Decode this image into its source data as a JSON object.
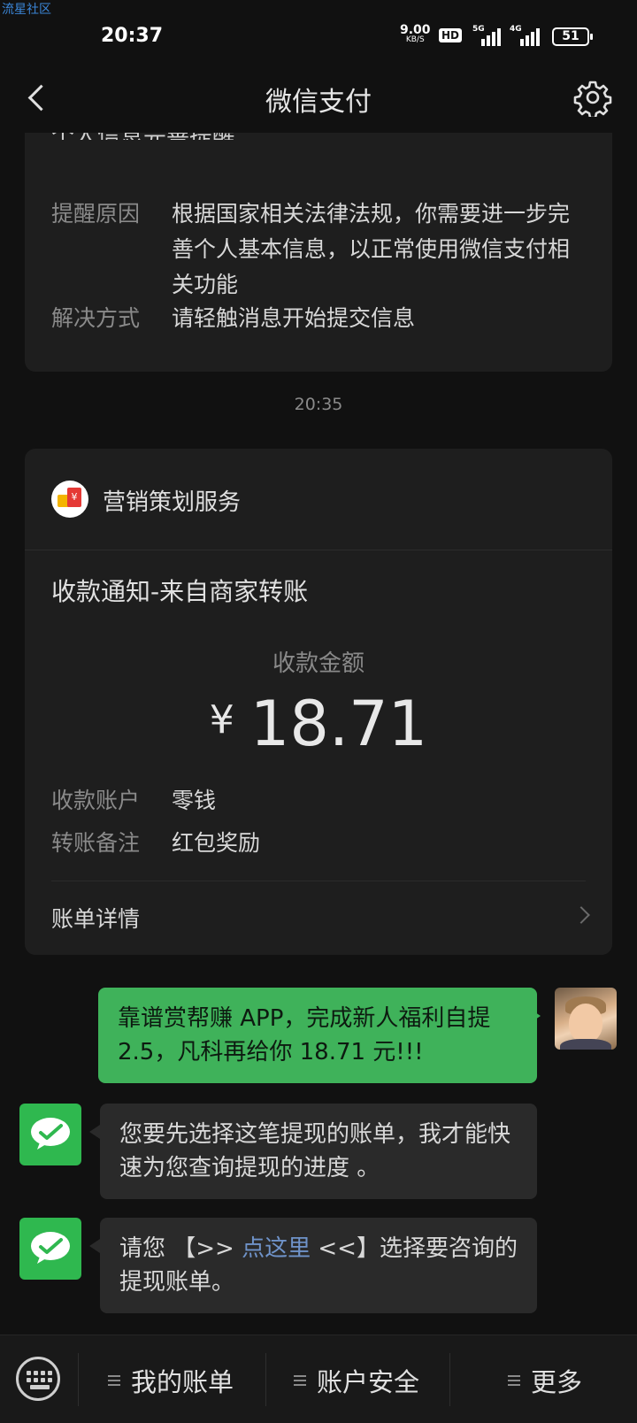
{
  "watermark": "流星社区",
  "status_bar": {
    "time": "20:37",
    "net_rate": "9.00",
    "net_unit": "KB/S",
    "hd": "HD",
    "signal1": "5G",
    "signal2": "4G",
    "battery": "51"
  },
  "nav": {
    "title": "微信支付",
    "back_icon": "back-arrow-icon",
    "settings_icon": "gear-icon"
  },
  "reminder_card": {
    "clipped_title": "个人信息完善提醒",
    "reason_label": "提醒原因",
    "reason_value": "根据国家相关法律法规，你需要进一步完善个人基本信息，以正常使用微信支付相关功能",
    "method_label": "解决方式",
    "method_value": "请轻触消息开始提交信息"
  },
  "timestamp": "20:35",
  "payment_card": {
    "service_name": "营销策划服务",
    "title": "收款通知-来自商家转账",
    "amount_label": "收款金额",
    "currency": "¥",
    "amount": "18.71",
    "account_label": "收款账户",
    "account_value": "零钱",
    "note_label": "转账备注",
    "note_value": "红包奖励",
    "detail_label": "账单详情"
  },
  "messages": {
    "outgoing": "靠谱赏帮赚 APP，完成新人福利自提 2.5，凡科再给你 18.71 元!!!",
    "incoming1": "您要先选择这笔提现的账单，我才能快速为您查询提现的进度 。",
    "incoming2_pre": "请您 【>> ",
    "incoming2_link": "点这里",
    "incoming2_post": " <<】选择要咨询的提现账单。"
  },
  "bottom_menu": {
    "item1": "我的账单",
    "item2": "账户安全",
    "item3": "更多"
  },
  "colors": {
    "accent_green": "#3fb25a",
    "wechat_green": "#2fb84f",
    "link_blue": "#6f93c9",
    "background": "#111111"
  }
}
